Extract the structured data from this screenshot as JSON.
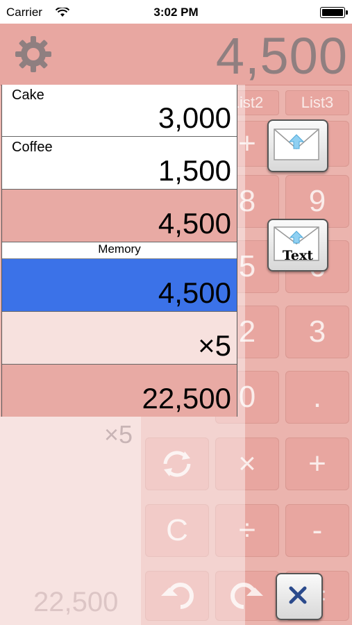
{
  "status": {
    "carrier": "Carrier",
    "time": "3:02 PM"
  },
  "header": {
    "display_value": "4,500",
    "settings_icon": "gear-icon"
  },
  "list": {
    "items": [
      {
        "label": "Cake",
        "value": "3,000"
      },
      {
        "label": "Coffee",
        "value": "1,500"
      }
    ],
    "subtotal": "4,500",
    "memory_label": "Memory",
    "memory_value": "4,500",
    "multiplier": "×5",
    "total": "22,500"
  },
  "background_calc": {
    "tabs": [
      "List2",
      "List3"
    ],
    "keys": [
      "8",
      "9",
      "5",
      "6",
      "2",
      "3",
      "0",
      ".",
      "×",
      "+",
      "C",
      "÷",
      "-",
      "="
    ],
    "faded_multiplier": "×5",
    "faded_total": "22,500"
  },
  "actions": {
    "mail_icon": "mail-upload-icon",
    "text_label": "Text",
    "close_icon": "close-icon"
  },
  "colors": {
    "accent_pink": "#e8a7a1",
    "memory_blue": "#3b72e8",
    "display_gray": "#8f7f80"
  }
}
